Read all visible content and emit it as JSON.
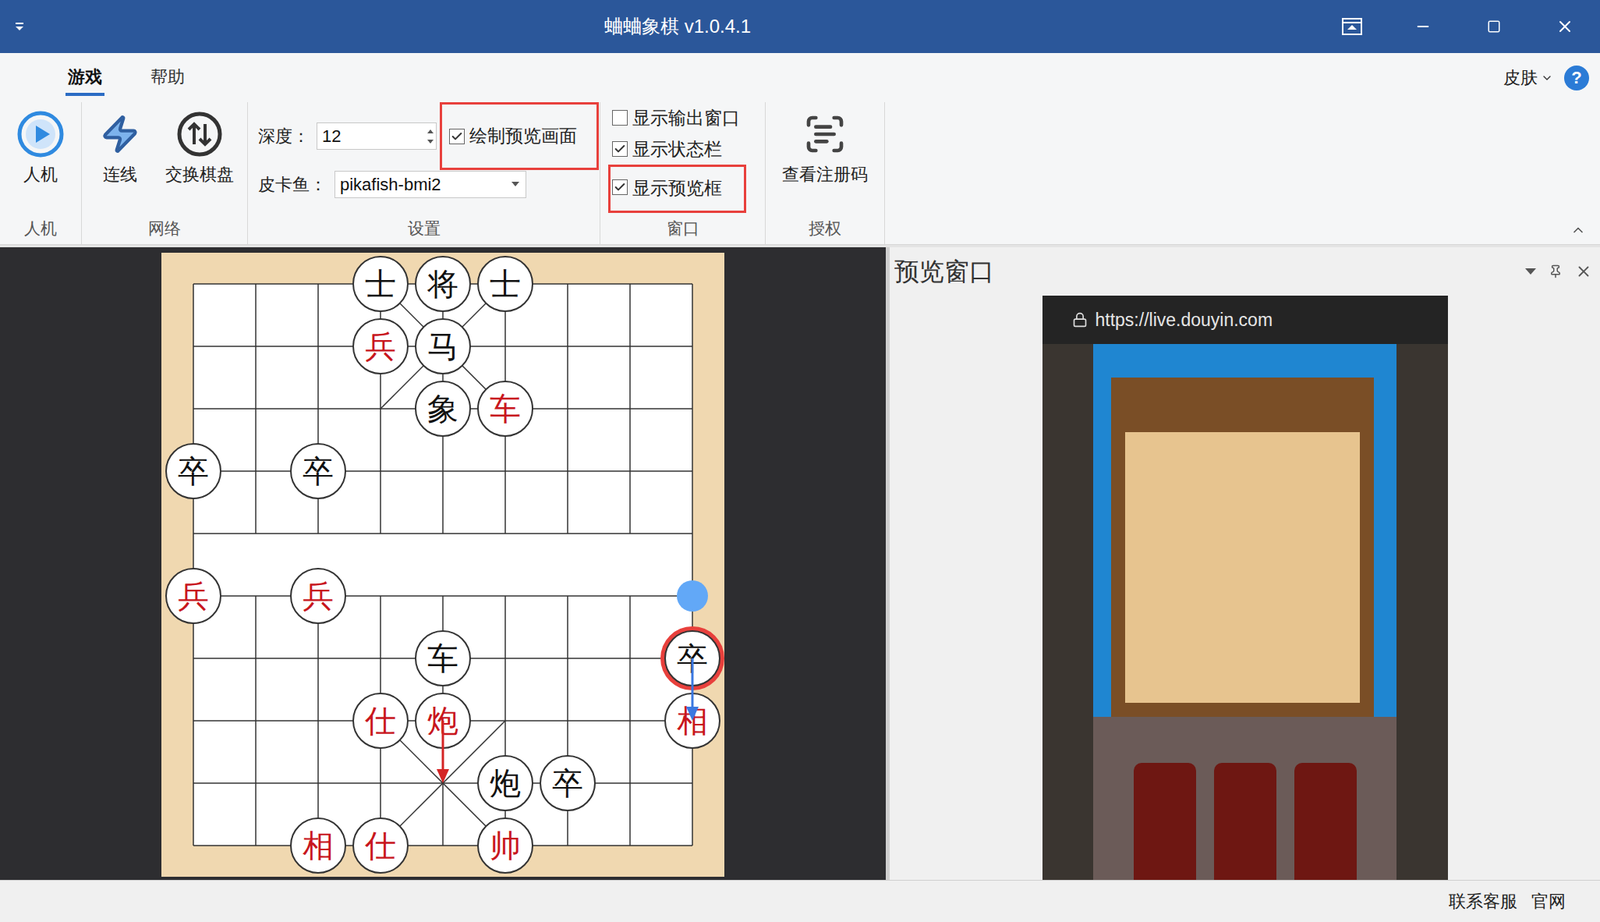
{
  "window": {
    "title": "蛐蛐象棋 v1.0.4.1"
  },
  "ribbon": {
    "tabs": [
      {
        "label": "游戏",
        "selected": true
      },
      {
        "label": "帮助",
        "selected": false
      }
    ],
    "skin_menu": "皮肤",
    "help_button": "?",
    "groups": {
      "ai": {
        "label": "人机",
        "button": "人机"
      },
      "network": {
        "label": "网络",
        "buttons": [
          "连线",
          "交换棋盘"
        ]
      },
      "settings": {
        "label": "设置",
        "depth": {
          "label": "深度：",
          "value": "12"
        },
        "engine": {
          "label": "皮卡鱼：",
          "value": "pikafish-bmi2"
        },
        "draw_preview": {
          "label": "绘制预览画面",
          "checked": true,
          "highlighted": true
        }
      },
      "window": {
        "label": "窗口",
        "options": [
          {
            "label": "显示输出窗口",
            "checked": false,
            "highlighted": false
          },
          {
            "label": "显示状态栏",
            "checked": true,
            "highlighted": false
          },
          {
            "label": "显示预览框",
            "checked": true,
            "highlighted": true
          }
        ]
      },
      "license": {
        "label": "授权",
        "button": "查看注册码"
      }
    }
  },
  "board": {
    "pieces": [
      {
        "char": "士",
        "col": 3,
        "row": 0,
        "side": "black",
        "highlighted": false
      },
      {
        "char": "将",
        "col": 4,
        "row": 0,
        "side": "black",
        "highlighted": false
      },
      {
        "char": "士",
        "col": 5,
        "row": 0,
        "side": "black",
        "highlighted": false
      },
      {
        "char": "兵",
        "col": 3,
        "row": 1,
        "side": "red",
        "highlighted": false
      },
      {
        "char": "马",
        "col": 4,
        "row": 1,
        "side": "black",
        "highlighted": false
      },
      {
        "char": "象",
        "col": 4,
        "row": 2,
        "side": "black",
        "highlighted": false
      },
      {
        "char": "车",
        "col": 5,
        "row": 2,
        "side": "red",
        "highlighted": false
      },
      {
        "char": "卒",
        "col": 0,
        "row": 3,
        "side": "black",
        "highlighted": false
      },
      {
        "char": "卒",
        "col": 2,
        "row": 3,
        "side": "black",
        "highlighted": false
      },
      {
        "char": "兵",
        "col": 0,
        "row": 5,
        "side": "red",
        "highlighted": false
      },
      {
        "char": "兵",
        "col": 2,
        "row": 5,
        "side": "red",
        "highlighted": false
      },
      {
        "char": "车",
        "col": 4,
        "row": 6,
        "side": "black",
        "highlighted": false
      },
      {
        "char": "卒",
        "col": 8,
        "row": 6,
        "side": "black",
        "highlighted": true
      },
      {
        "char": "仕",
        "col": 3,
        "row": 7,
        "side": "red",
        "highlighted": false
      },
      {
        "char": "炮",
        "col": 4,
        "row": 7,
        "side": "red",
        "highlighted": false
      },
      {
        "char": "相",
        "col": 8,
        "row": 7,
        "side": "red",
        "highlighted": false
      },
      {
        "char": "炮",
        "col": 5,
        "row": 8,
        "side": "black",
        "highlighted": false
      },
      {
        "char": "卒",
        "col": 6,
        "row": 8,
        "side": "black",
        "highlighted": false
      },
      {
        "char": "相",
        "col": 2,
        "row": 9,
        "side": "red",
        "highlighted": false
      },
      {
        "char": "仕",
        "col": 3,
        "row": 9,
        "side": "red",
        "highlighted": false
      },
      {
        "char": "帅",
        "col": 5,
        "row": 9,
        "side": "red",
        "highlighted": false
      }
    ],
    "marker": {
      "col": 8,
      "row": 5
    },
    "arrows": [
      {
        "from": [
          8,
          6
        ],
        "to": [
          8,
          7
        ],
        "color": "#3b78e0"
      },
      {
        "from": [
          4,
          7
        ],
        "to": [
          4,
          8
        ],
        "color": "#d42424"
      }
    ]
  },
  "preview": {
    "title": "预览窗口",
    "url": "https://live.douyin.com"
  },
  "status_bar": [
    "联系客服",
    "官网"
  ]
}
